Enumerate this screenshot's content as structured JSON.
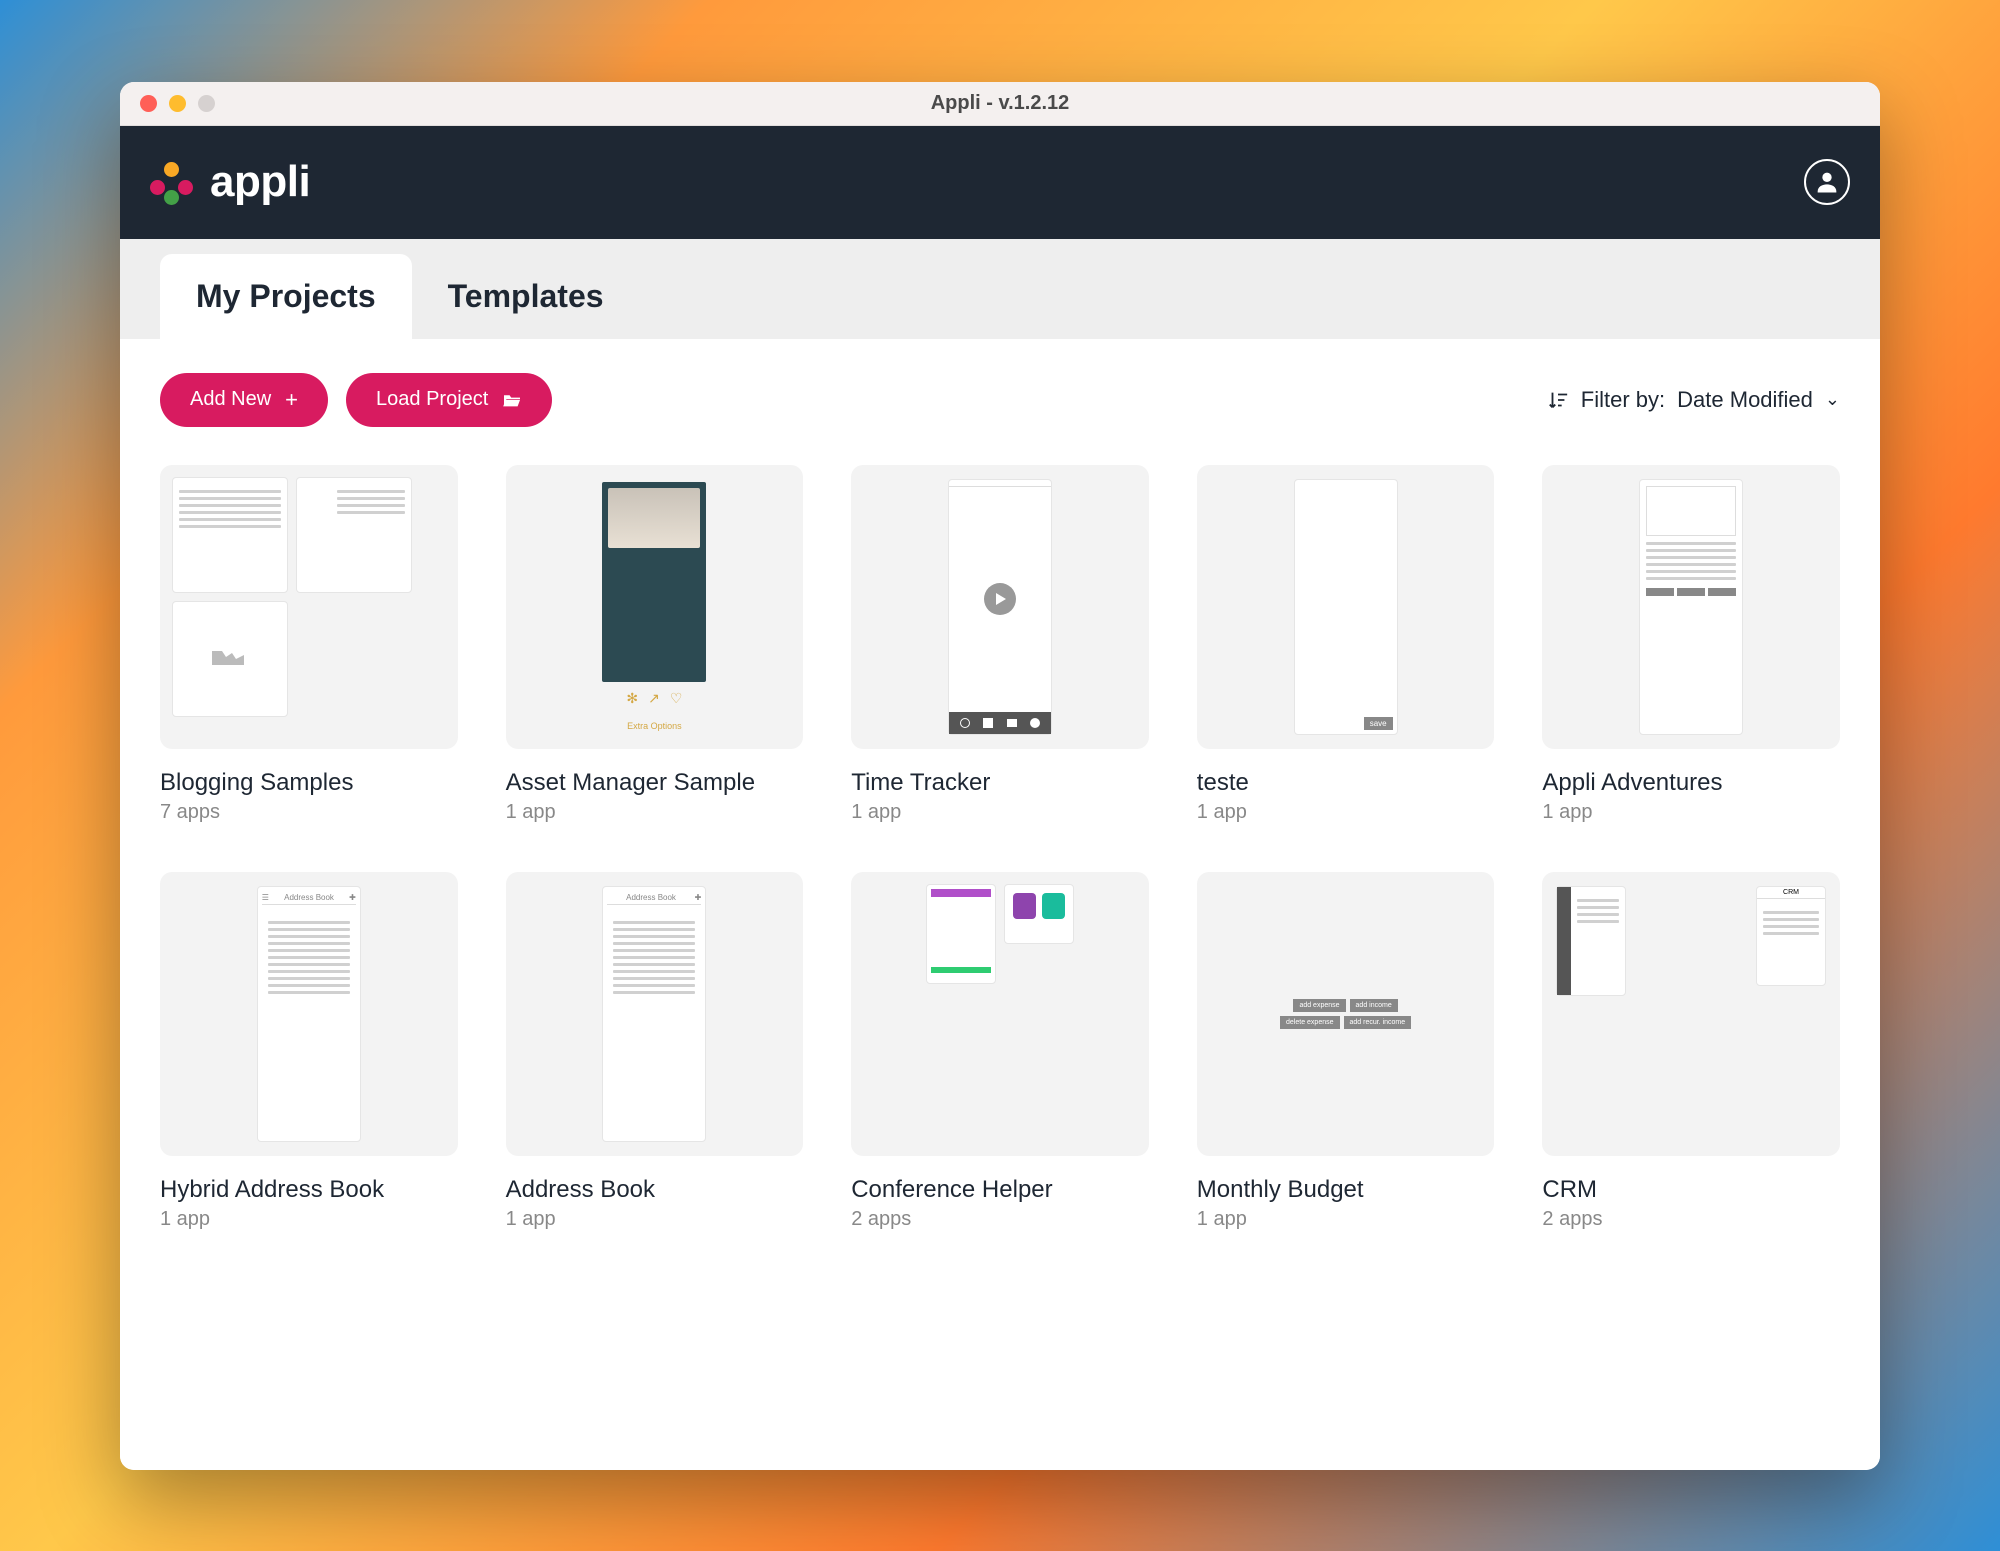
{
  "window": {
    "title": "Appli - v.1.2.12"
  },
  "brand": {
    "name": "appli"
  },
  "tabs": [
    {
      "label": "My Projects",
      "active": true
    },
    {
      "label": "Templates",
      "active": false
    }
  ],
  "toolbar": {
    "add_new_label": "Add New",
    "load_project_label": "Load Project"
  },
  "filter": {
    "prefix": "Filter by:",
    "value": "Date Modified"
  },
  "projects": [
    {
      "title": "Blogging Samples",
      "sub": "7 apps",
      "thumb": "grid2x2"
    },
    {
      "title": "Asset Manager Sample",
      "sub": "1 app",
      "thumb": "asset"
    },
    {
      "title": "Time Tracker",
      "sub": "1 app",
      "thumb": "timetracker"
    },
    {
      "title": "teste",
      "sub": "1 app",
      "thumb": "save"
    },
    {
      "title": "Appli Adventures",
      "sub": "1 app",
      "thumb": "form"
    },
    {
      "title": "Hybrid Address Book",
      "sub": "1 app",
      "thumb": "addr-plus"
    },
    {
      "title": "Address Book",
      "sub": "1 app",
      "thumb": "addr"
    },
    {
      "title": "Conference Helper",
      "sub": "2 apps",
      "thumb": "conference"
    },
    {
      "title": "Monthly Budget",
      "sub": "1 app",
      "thumb": "budget"
    },
    {
      "title": "CRM",
      "sub": "2 apps",
      "thumb": "crm"
    }
  ],
  "thumb_meta": {
    "addr_title": "Address Book",
    "save_label": "save"
  }
}
